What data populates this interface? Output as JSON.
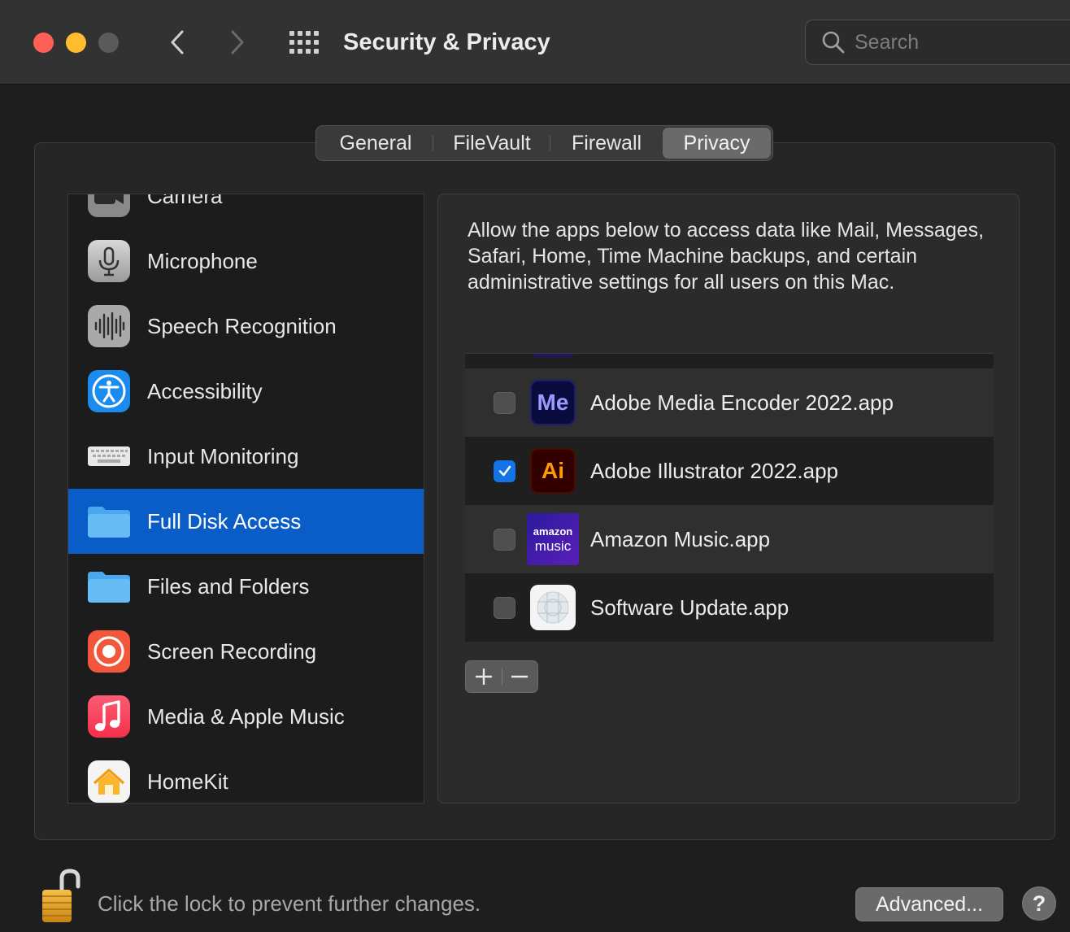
{
  "window": {
    "title": "Security & Privacy",
    "search_placeholder": "Search"
  },
  "tabs": [
    {
      "label": "General",
      "active": false
    },
    {
      "label": "FileVault",
      "active": false
    },
    {
      "label": "Firewall",
      "active": false
    },
    {
      "label": "Privacy",
      "active": true
    }
  ],
  "sidebar": {
    "items": [
      {
        "label": "Camera",
        "icon": "camera-icon"
      },
      {
        "label": "Microphone",
        "icon": "microphone-icon"
      },
      {
        "label": "Speech Recognition",
        "icon": "waveform-icon"
      },
      {
        "label": "Accessibility",
        "icon": "accessibility-icon"
      },
      {
        "label": "Input Monitoring",
        "icon": "keyboard-icon"
      },
      {
        "label": "Full Disk Access",
        "icon": "folder-icon",
        "selected": true
      },
      {
        "label": "Files and Folders",
        "icon": "folder-icon"
      },
      {
        "label": "Screen Recording",
        "icon": "record-icon"
      },
      {
        "label": "Media & Apple Music",
        "icon": "music-note-icon"
      },
      {
        "label": "HomeKit",
        "icon": "home-icon"
      }
    ]
  },
  "detail": {
    "description": "Allow the apps below to access data like Mail, Messages, Safari, Home, Time Machine backups, and certain administrative settings for all users on this Mac.",
    "apps": [
      {
        "label": "Adobe Media Encoder 2022.app",
        "checked": false,
        "icon_text": "Me",
        "icon": "adobe-media-encoder-icon"
      },
      {
        "label": "Adobe Illustrator 2022.app",
        "checked": true,
        "icon_text": "Ai",
        "icon": "adobe-illustrator-icon"
      },
      {
        "label": "Amazon Music.app",
        "checked": false,
        "icon_text_top": "amazon",
        "icon_text_bottom": "music",
        "icon": "amazon-music-icon"
      },
      {
        "label": "Software Update.app",
        "checked": false,
        "icon": "software-update-icon"
      }
    ],
    "add_label": "+",
    "remove_label": "−"
  },
  "footer": {
    "lock_text": "Click the lock to prevent further changes.",
    "advanced_label": "Advanced...",
    "help_label": "?"
  },
  "colors": {
    "selection": "#0a5dc6",
    "checkbox_checked": "#1473e6",
    "close": "#fe5f57",
    "minimize": "#febc2e"
  }
}
